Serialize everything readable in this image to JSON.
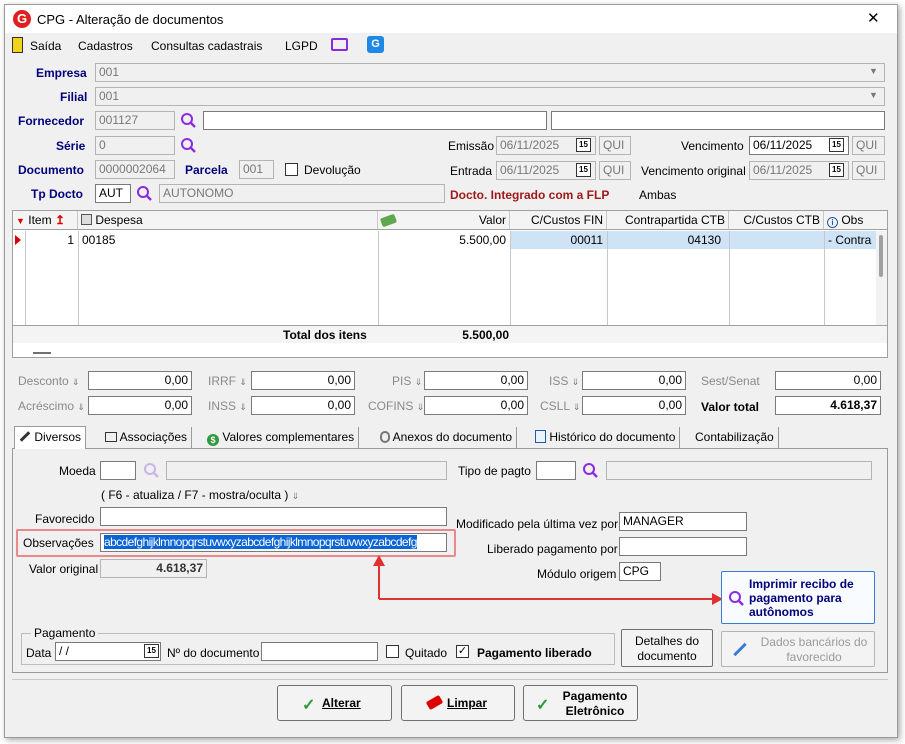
{
  "window": {
    "title": "CPG - Alteração de documentos",
    "close_label": "✕"
  },
  "menu": {
    "items": [
      "Saída",
      "Cadastros",
      "Consultas cadastrais",
      "LGPD"
    ]
  },
  "form": {
    "empresa_label": "Empresa",
    "empresa_value": "001",
    "filial_label": "Filial",
    "filial_value": "001",
    "fornecedor_label": "Fornecedor",
    "fornecedor_value": "001127",
    "serie_label": "Série",
    "serie_value": "0",
    "documento_label": "Documento",
    "documento_value": "0000002064",
    "parcela_label": "Parcela",
    "parcela_value": "001",
    "devolucao_label": "Devolução",
    "tp_docto_label": "Tp Docto",
    "tp_docto_value": "AUT",
    "tp_docto_desc": "AUTONOMO",
    "emissao_label": "Emissão",
    "emissao_value": "06/11/2025",
    "emissao_dow": "QUI",
    "entrada_label": "Entrada",
    "entrada_value": "06/11/2025",
    "entrada_dow": "QUI",
    "vencimento_label": "Vencimento",
    "vencimento_value": "06/11/2025",
    "vencimento_dow": "QUI",
    "venc_original_label": "Vencimento original",
    "venc_original_value": "06/11/2025",
    "venc_original_dow": "QUI",
    "integrado_text": "Docto. Integrado com a FLP",
    "ambas_text": "Ambas",
    "cal_glyph": "15"
  },
  "grid": {
    "headers": [
      "Item",
      "Despesa",
      "Valor",
      "C/Custos FIN",
      "Contrapartida CTB",
      "C/Custos CTB",
      "Obs"
    ],
    "row": {
      "item": "1",
      "despesa": "00185",
      "valor": "5.500,00",
      "ccfin": "00011",
      "contrapartida": "04130",
      "ccctb": "",
      "obs": "- Contra"
    },
    "total_label": "Total dos itens",
    "total_value": "5.500,00"
  },
  "totals": {
    "desconto_label": "Desconto",
    "desconto_value": "0,00",
    "irrf_label": "IRRF",
    "irrf_value": "0,00",
    "pis_label": "PIS",
    "pis_value": "0,00",
    "iss_label": "ISS",
    "iss_value": "0,00",
    "sest_label": "Sest/Senat",
    "sest_value": "0,00",
    "acrescimo_label": "Acréscimo",
    "acrescimo_value": "0,00",
    "inss_label": "INSS",
    "inss_value": "0,00",
    "cofins_label": "COFINS",
    "cofins_value": "0,00",
    "csll_label": "CSLL",
    "csll_value": "0,00",
    "valor_total_label": "Valor total",
    "valor_total_value": "4.618,37"
  },
  "tabs": [
    "Diversos",
    "Associações",
    "Valores complementares",
    "Anexos do documento",
    "Histórico do documento",
    "Contabilização"
  ],
  "diversos": {
    "moeda_label": "Moeda",
    "tipo_pagto_label": "Tipo de pagto",
    "hint": "( F6 - atualiza / F7 - mostra/oculta )",
    "favorecido_label": "Favorecido",
    "observacoes_label": "Observações",
    "observacoes_value": "abcdefghijklmnopqrstuvwxyzabcdefghijklmnopqrstuvwxyzabcdefg",
    "valor_original_label": "Valor original",
    "valor_original_value": "4.618,37",
    "modificado_label": "Modificado pela última vez por",
    "modificado_value": "MANAGER",
    "liberado_label": "Liberado pagamento por",
    "liberado_value": "",
    "modulo_label": "Módulo origem",
    "modulo_value": "CPG",
    "imprimir_label": "Imprimir recibo de pagamento para autônomos",
    "pagamento_group": "Pagamento",
    "data_label": "Data",
    "data_value": " /  /",
    "ndoc_label": "Nº do documento",
    "quitado_label": "Quitado",
    "pag_liberado_label": "Pagamento liberado",
    "detalhes_label": "Detalhes do documento",
    "dados_bancarios_label": "Dados bancários do favorecido"
  },
  "actions": {
    "alterar": "Alterar",
    "limpar": "Limpar",
    "pagamento": "Pagamento Eletrônico"
  },
  "colors": {
    "accent": "#00007a",
    "selection": "#0a64d6",
    "annotation": "#e03030",
    "row_selected": "#cfe3f7"
  }
}
